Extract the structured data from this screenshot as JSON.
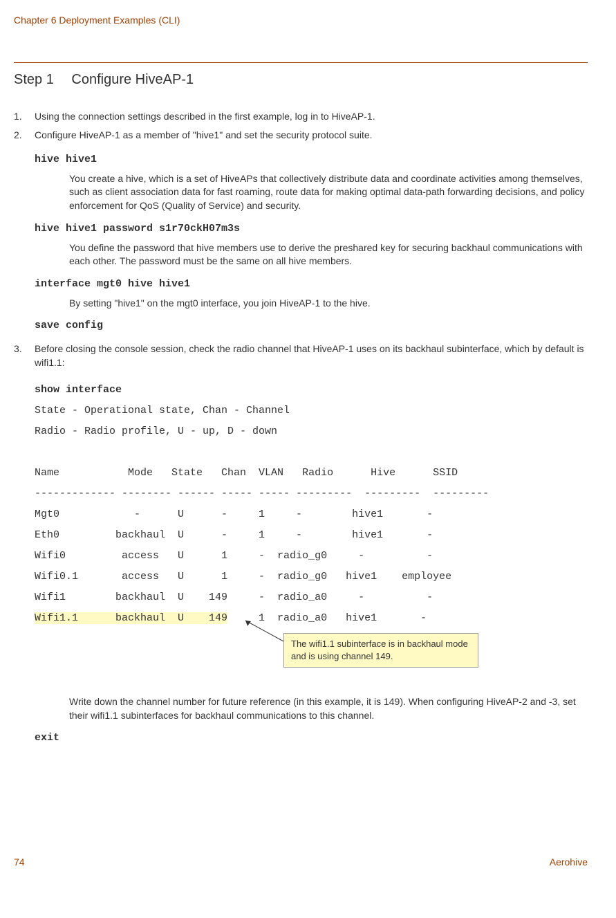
{
  "header": "Chapter 6 Deployment Examples (CLI)",
  "step": {
    "label": "Step 1",
    "title": "Configure HiveAP-1"
  },
  "list": {
    "item1": "Using the connection settings described in the first example, log in to HiveAP-1.",
    "item2": "Configure HiveAP-1 as a member of \"hive1\" and set the security protocol suite.",
    "item3": "Before closing the console session, check the radio channel that HiveAP-1 uses on its backhaul subinterface, which by default is wifi1.1:"
  },
  "commands": {
    "c1": "hive hive1",
    "c2": "hive hive1 password s1r70ckH07m3s",
    "c3": "interface mgt0 hive hive1",
    "c4": "save config",
    "c5": "show interface",
    "exit": "exit"
  },
  "explanations": {
    "e1": "You create a hive, which is a set of HiveAPs that collectively distribute data and coordinate activities among themselves, such as client association data for fast roaming, route data for making optimal data-path forwarding decisions, and policy enforcement for QoS (Quality of Service) and security.",
    "e2": "You define the password that hive members use to derive the preshared key for securing backhaul communications with each other. The password must be the same on all hive members.",
    "e3": "By setting \"hive1\" on the mgt0 interface, you join HiveAP-1 to the hive.",
    "final": "Write down the channel number for future reference (in this example, it is 149). When configuring HiveAP-2 and -3, set their wifi1.1 subinterfaces for backhaul communications to this channel."
  },
  "output": {
    "legend1": "State - Operational state, Chan - Channel",
    "legend2": "Radio - Radio profile, U - up, D - down",
    "header_row": "Name           Mode   State   Chan  VLAN   Radio      Hive      SSID",
    "divider": "------------- -------- ------ ----- ----- ---------  ---------  ---------",
    "r_mgt0": "Mgt0            -      U      -     1     -        hive1       -",
    "r_eth0": "Eth0         backhaul  U      -     1     -        hive1       -",
    "r_wifi0": "Wifi0         access   U      1     -  radio_g0     -          -",
    "r_wifi01": "Wifi0.1       access   U      1     -  radio_g0   hive1    employee",
    "r_wifi1": "Wifi1        backhaul  U    149     -  radio_a0     -          -",
    "r_wifi11_a": "Wifi1.1      backhaul  U    149",
    "r_wifi11_b": "     1  radio_a0   hive1       -"
  },
  "annotation": "The wifi1.1 subinterface is in backhaul mode and is using channel 149.",
  "footer": {
    "page": "74",
    "brand": "Aerohive"
  },
  "chart_data": {
    "type": "table",
    "title": "show interface output",
    "columns": [
      "Name",
      "Mode",
      "State",
      "Chan",
      "VLAN",
      "Radio",
      "Hive",
      "SSID"
    ],
    "rows": [
      {
        "Name": "Mgt0",
        "Mode": "-",
        "State": "U",
        "Chan": "-",
        "VLAN": "1",
        "Radio": "-",
        "Hive": "hive1",
        "SSID": "-"
      },
      {
        "Name": "Eth0",
        "Mode": "backhaul",
        "State": "U",
        "Chan": "-",
        "VLAN": "1",
        "Radio": "-",
        "Hive": "hive1",
        "SSID": "-"
      },
      {
        "Name": "Wifi0",
        "Mode": "access",
        "State": "U",
        "Chan": "1",
        "VLAN": "-",
        "Radio": "radio_g0",
        "Hive": "-",
        "SSID": "-"
      },
      {
        "Name": "Wifi0.1",
        "Mode": "access",
        "State": "U",
        "Chan": "1",
        "VLAN": "-",
        "Radio": "radio_g0",
        "Hive": "hive1",
        "SSID": "employee"
      },
      {
        "Name": "Wifi1",
        "Mode": "backhaul",
        "State": "U",
        "Chan": "149",
        "VLAN": "-",
        "Radio": "radio_a0",
        "Hive": "-",
        "SSID": "-"
      },
      {
        "Name": "Wifi1.1",
        "Mode": "backhaul",
        "State": "U",
        "Chan": "149",
        "VLAN": "1",
        "Radio": "radio_a0",
        "Hive": "hive1",
        "SSID": "-"
      }
    ]
  }
}
